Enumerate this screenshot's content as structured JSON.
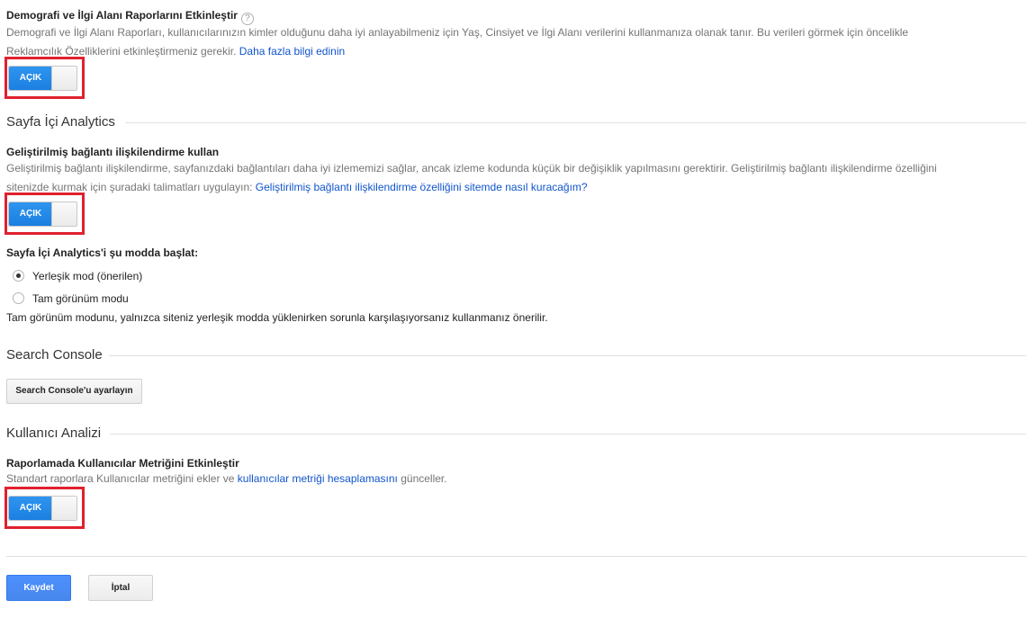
{
  "demographics": {
    "title": "Demografi ve İlgi Alanı Raporlarını Etkinleştir",
    "help_icon": "?",
    "desc_line1": "Demografi ve İlgi Alanı Raporları, kullanıcılarınızın kimler olduğunu daha iyi anlayabilmeniz için Yaş, Cinsiyet ve İlgi Alanı verilerini kullanmanıza olanak tanır. Bu verileri görmek için öncelikle",
    "desc_line2": "Reklamcılık Özelliklerini etkinleştirmeniz gerekir.",
    "link": "Daha fazla bilgi edinin",
    "toggle_label": "AÇIK"
  },
  "in_page_analytics": {
    "section_title": "Sayfa İçi Analytics",
    "enhanced_link": {
      "title": "Geliştirilmiş bağlantı ilişkilendirme kullan",
      "desc_line1": "Geliştirilmiş bağlantı ilişkilendirme, sayfanızdaki bağlantıları daha iyi izlememizi sağlar, ancak izleme kodunda küçük bir değişiklik yapılmasını gerektirir. Geliştirilmiş bağlantı ilişkilendirme özelliğini",
      "desc_line2": "sitenizde kurmak için şuradaki talimatları uygulayın:",
      "link": "Geliştirilmiş bağlantı ilişkilendirme özelliğini sitemde nasıl kuracağım?",
      "toggle_label": "AÇIK"
    },
    "mode": {
      "title": "Sayfa İçi Analytics'i şu modda başlat:",
      "options": [
        "Yerleşik mod (önerilen)",
        "Tam görünüm modu"
      ],
      "selected": "Yerleşik mod (önerilen)",
      "note": "Tam görünüm modunu, yalnızca siteniz yerleşik modda yüklenirken sorunla karşılaşıyorsanız kullanmanız önerilir."
    }
  },
  "search_console": {
    "section_title": "Search Console",
    "button_label": "Search Console'u ayarlayın"
  },
  "user_analysis": {
    "section_title": "Kullanıcı Analizi",
    "title": "Raporlamada Kullanıcılar Metriğini Etkinleştir",
    "desc_prefix": "Standart raporlara Kullanıcılar metriğini ekler ve",
    "link": "kullanıcılar metriği hesaplamasını",
    "desc_suffix": "günceller.",
    "toggle_label": "AÇIK"
  },
  "actions": {
    "save_label": "Kaydet",
    "cancel_label": "İptal"
  },
  "colors": {
    "highlight": "#e0212e",
    "toggle_on": "#1e88e5",
    "link": "#1155cc",
    "primary_button": "#4d90fe"
  }
}
